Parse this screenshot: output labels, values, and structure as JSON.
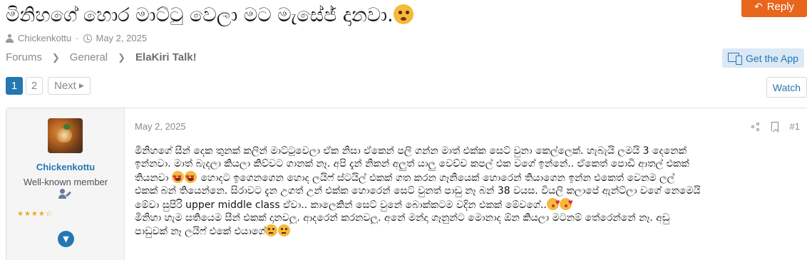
{
  "thread": {
    "title": "මිනිහගේ හොර මාට්ටු වෙලා මට මැසේජ් දානවා.",
    "author": "Chickenkottu",
    "date": "May 2, 2025"
  },
  "reply_button": {
    "label": "Reply",
    "icon": "reply-icon"
  },
  "breadcrumb": {
    "items": [
      "Forums",
      "General",
      "ElaKiri Talk!"
    ]
  },
  "get_app": {
    "label": "Get the App",
    "icon": "devices-icon"
  },
  "pagination": {
    "pages": [
      "1",
      "2"
    ],
    "current": "1",
    "next_label": "Next"
  },
  "watch_button": {
    "label": "Watch"
  },
  "post": {
    "username": "Chickenkottu",
    "user_title": "Well-known member",
    "rating_stars": "★★★★☆",
    "date": "May 2, 2025",
    "post_number": "#1",
    "body_lines": [
      "මිනිහගේ සීන් දෙක තුනක් කලින් මාට්ටුවෙලා ඒක නිසා ඒකෙන් පලි ගන්න මාත් එක්ක සෙට් වුනා කෙල්ලෙක්. හැබැයි ලමයි 3 දෙනෙක්",
      "ඉන්නවා. මාත් බැදලා කියලා කිව්වට ගානක් නෑ. අපි දැන් නිකන් අලුත් යාලු වෙච්ච කපල් එක වගේ ඉන්නේ.. ඒකෙත් පොඩි ආතල් එකක්",
      "තියනවා",
      "හොදට ඉගෙනගෙන හොද ලයිෆ් ස්ටයිල් එකක් ගත කරන ගෑනියෙක් හොරෙන් තියාගෙන ඉන්න එකෙත් වෙනම ලල්",
      "එකක් බන් තියෙන්නෙ. සිරාවට දැන උගත් උන් එක්ක හොරෙන් සෙට් වුනත් පාඩු නෑ බන් 38 වයස. වියලි කලාපේ ඇන්ට්ලා වගේ නෙමෙයි",
      "මේවා සුපිරි upper middle class ඒවා.. කාලෙකින් සෙට් වුනේ බොක්කටම වදින එකක් මේවගේ..",
      "මිනිහා හැම සතියෙම සීන් එකක් දානවලු. ආදරෙන් කරනවලු. අනේ මන්දා ගෑනුන්ට මොනාද ඕන කියලා මටනම් තේරෙන්නේ නෑ. අඩු",
      "පාඩුවක් නෑ ලයිෆ් එකේ එයාගේ"
    ]
  }
}
